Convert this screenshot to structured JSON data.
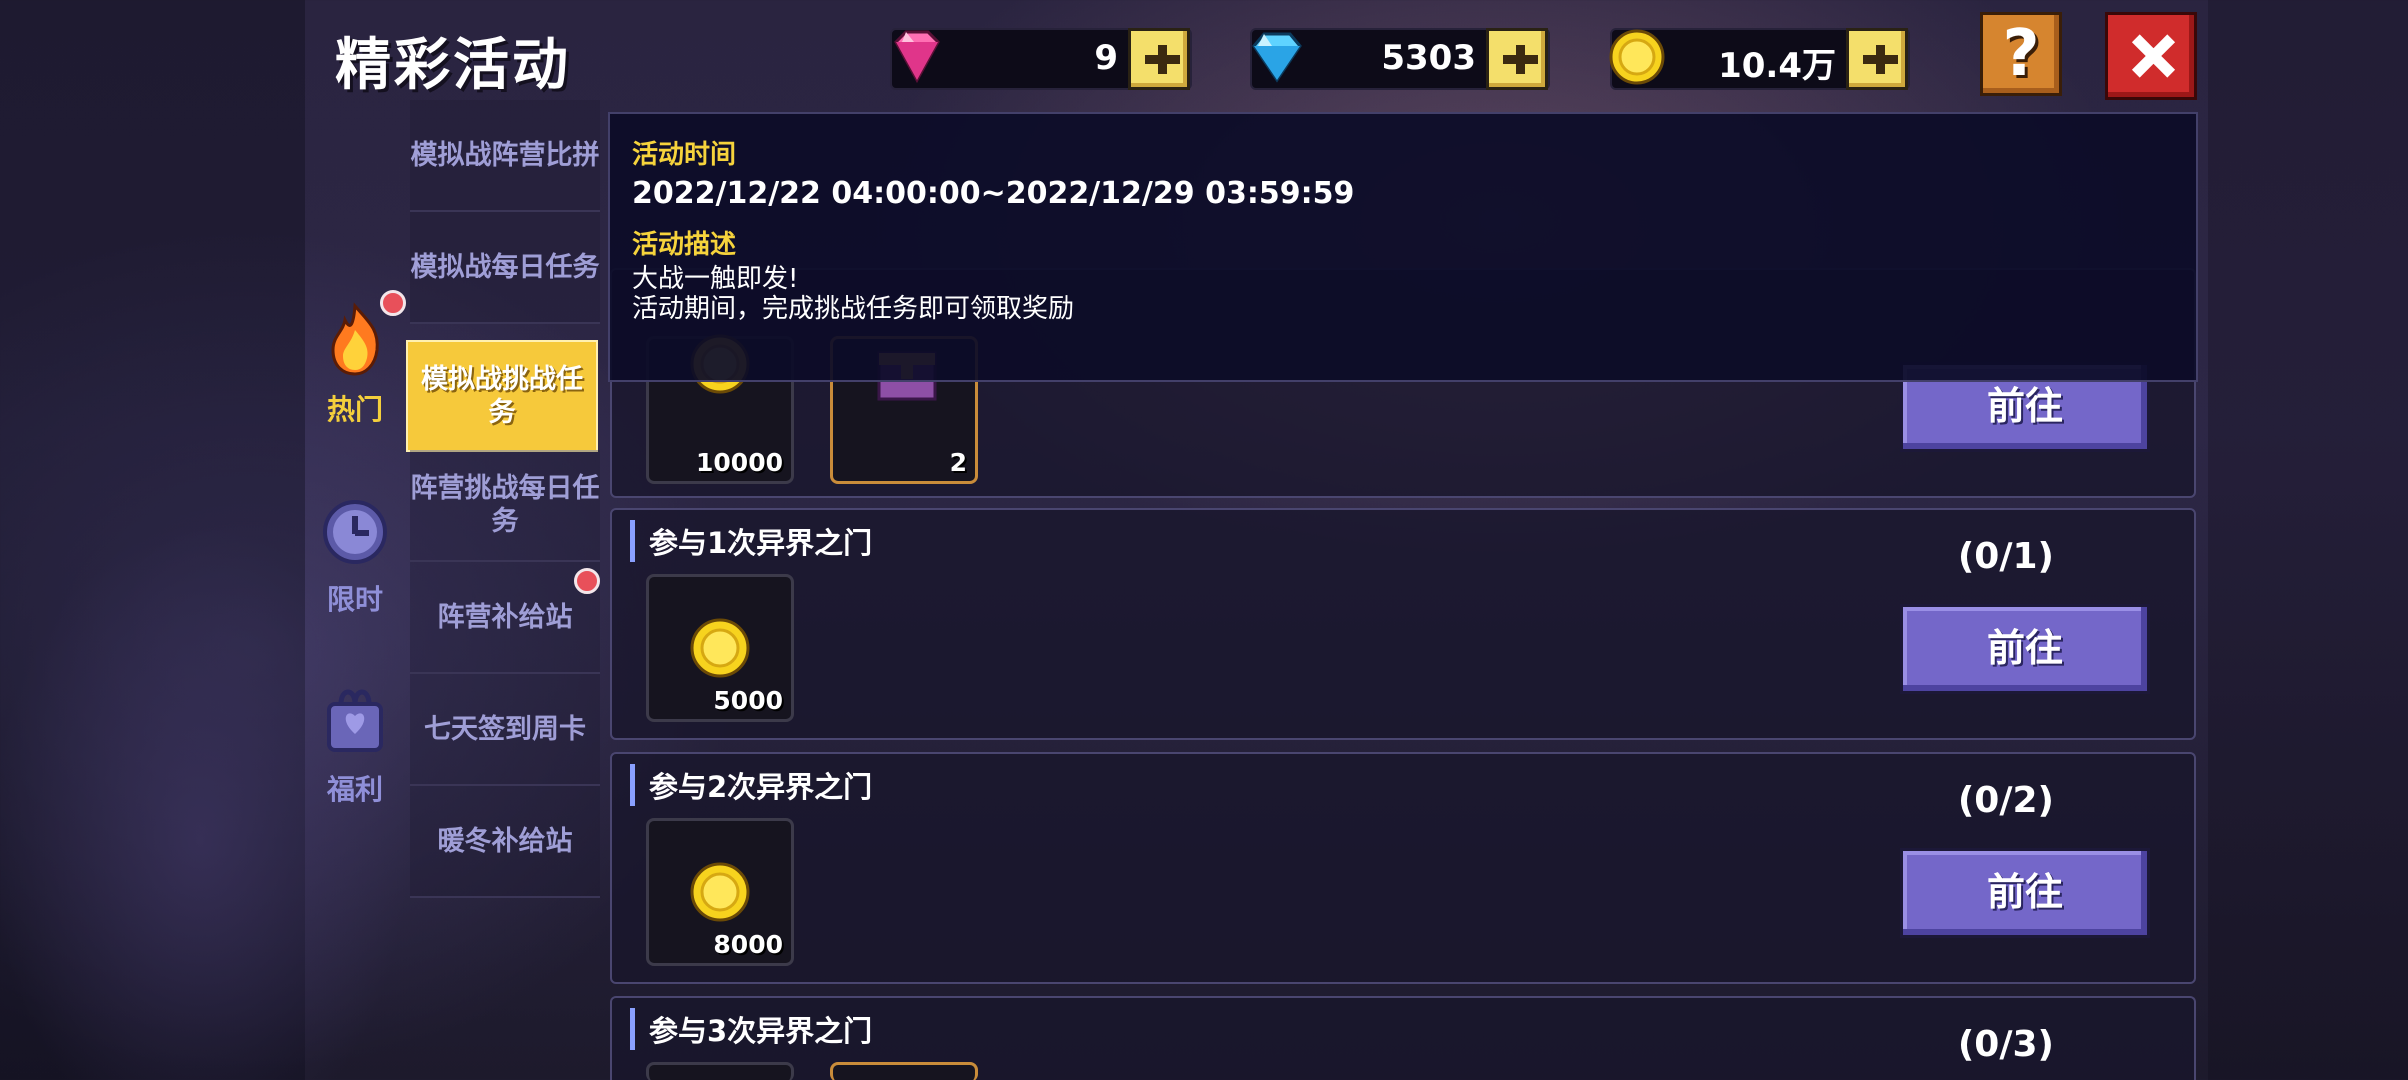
{
  "header": {
    "title": "精彩活动",
    "resources": [
      {
        "icon": "pink-gem-icon",
        "value": "9"
      },
      {
        "icon": "blue-diamond-icon",
        "value": "5303"
      },
      {
        "icon": "gold-coin-icon",
        "value": "10.4万"
      }
    ],
    "help_label": "?"
  },
  "categories": [
    {
      "label": "热门",
      "icon": "fire-icon",
      "active": true,
      "has_dot": true
    },
    {
      "label": "限时",
      "icon": "clock-icon",
      "active": false,
      "has_dot": false
    },
    {
      "label": "福利",
      "icon": "gift-bag-icon",
      "active": false,
      "has_dot": false
    }
  ],
  "submenu": [
    {
      "label": "模拟战阵营比拼",
      "active": false
    },
    {
      "label": "模拟战每日任务",
      "active": false
    },
    {
      "label": "模拟战挑战任务",
      "active": true
    },
    {
      "label": "阵营挑战每日任务",
      "active": false
    },
    {
      "label": "阵营补给站",
      "active": false,
      "has_dot": true
    },
    {
      "label": "七天签到周卡",
      "active": false
    },
    {
      "label": "暖冬补给站",
      "active": false
    }
  ],
  "info": {
    "time_label": "活动时间",
    "time_value": "2022/12/22 04:00:00~2022/12/29 03:59:59",
    "desc_label": "活动描述",
    "desc_line1": "大战一触即发!",
    "desc_line2": "活动期间，完成挑战任务即可领取奖励"
  },
  "tasks": [
    {
      "title": "",
      "progress": "",
      "rewards": [
        {
          "icon": "gold-coin-icon",
          "amount": "10000"
        },
        {
          "icon": "chest-icon",
          "amount": "2"
        }
      ],
      "button": "前往"
    },
    {
      "title": "参与1次异界之门",
      "progress": "(0/1)",
      "rewards": [
        {
          "icon": "gold-coin-icon",
          "amount": "5000"
        }
      ],
      "button": "前往"
    },
    {
      "title": "参与2次异界之门",
      "progress": "(0/2)",
      "rewards": [
        {
          "icon": "gold-coin-icon",
          "amount": "8000"
        }
      ],
      "button": "前往"
    },
    {
      "title": "参与3次异界之门",
      "progress": "(0/3)",
      "rewards": [],
      "button": ""
    }
  ],
  "colors": {
    "accent_yellow": "#f6c93b",
    "button_purple": "#7467c9",
    "close_red": "#d02c2c",
    "help_orange": "#d6852f"
  }
}
